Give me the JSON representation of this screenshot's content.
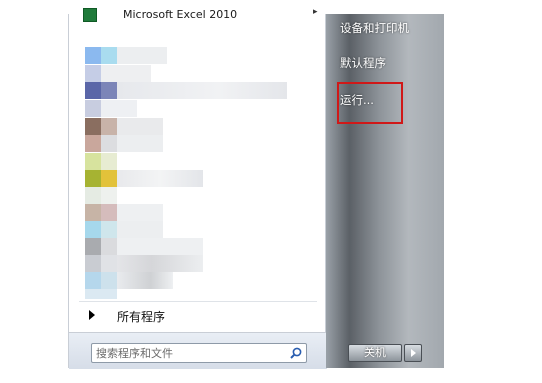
{
  "pinned_top": {
    "label": "Microsoft Excel 2010"
  },
  "all_programs_label": "所有程序",
  "search": {
    "placeholder": "搜索程序和文件"
  },
  "right_pane": {
    "items": [
      "设备和打印机",
      "默认程序",
      "运行..."
    ]
  },
  "shutdown": {
    "label": "关机"
  },
  "colors": {
    "highlight": "#d01818",
    "excel_green": "#1f7a3a"
  }
}
